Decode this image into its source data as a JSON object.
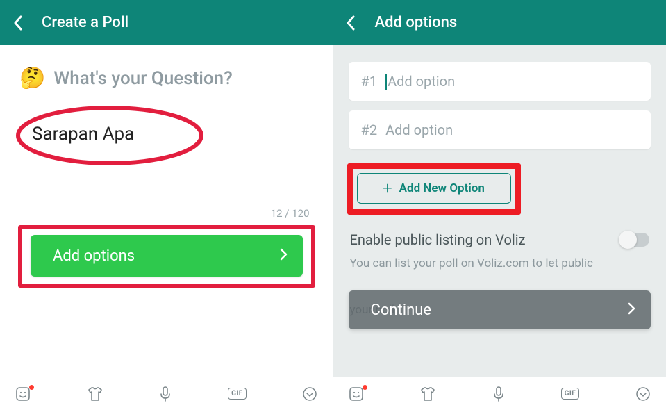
{
  "left": {
    "title": "Create a Poll",
    "question_prompt": "What's your Question?",
    "emoji": "🤔",
    "answer": "Sarapan Apa",
    "counter": "12 / 120",
    "add_options_label": "Add options"
  },
  "right": {
    "title": "Add options",
    "options": [
      {
        "num": "#1",
        "placeholder": "Add option",
        "has_cursor": true
      },
      {
        "num": "#2",
        "placeholder": "Add option",
        "has_cursor": false
      }
    ],
    "add_new_label": "Add New Option",
    "toggle_label": "Enable public listing on Voliz",
    "toggle_on": false,
    "desc_line1": "You can list your poll on Voliz.com to let public",
    "desc_line2": "your poll.",
    "continue_label": "Continue"
  },
  "keyboard": {
    "gif_label": "GIF"
  }
}
